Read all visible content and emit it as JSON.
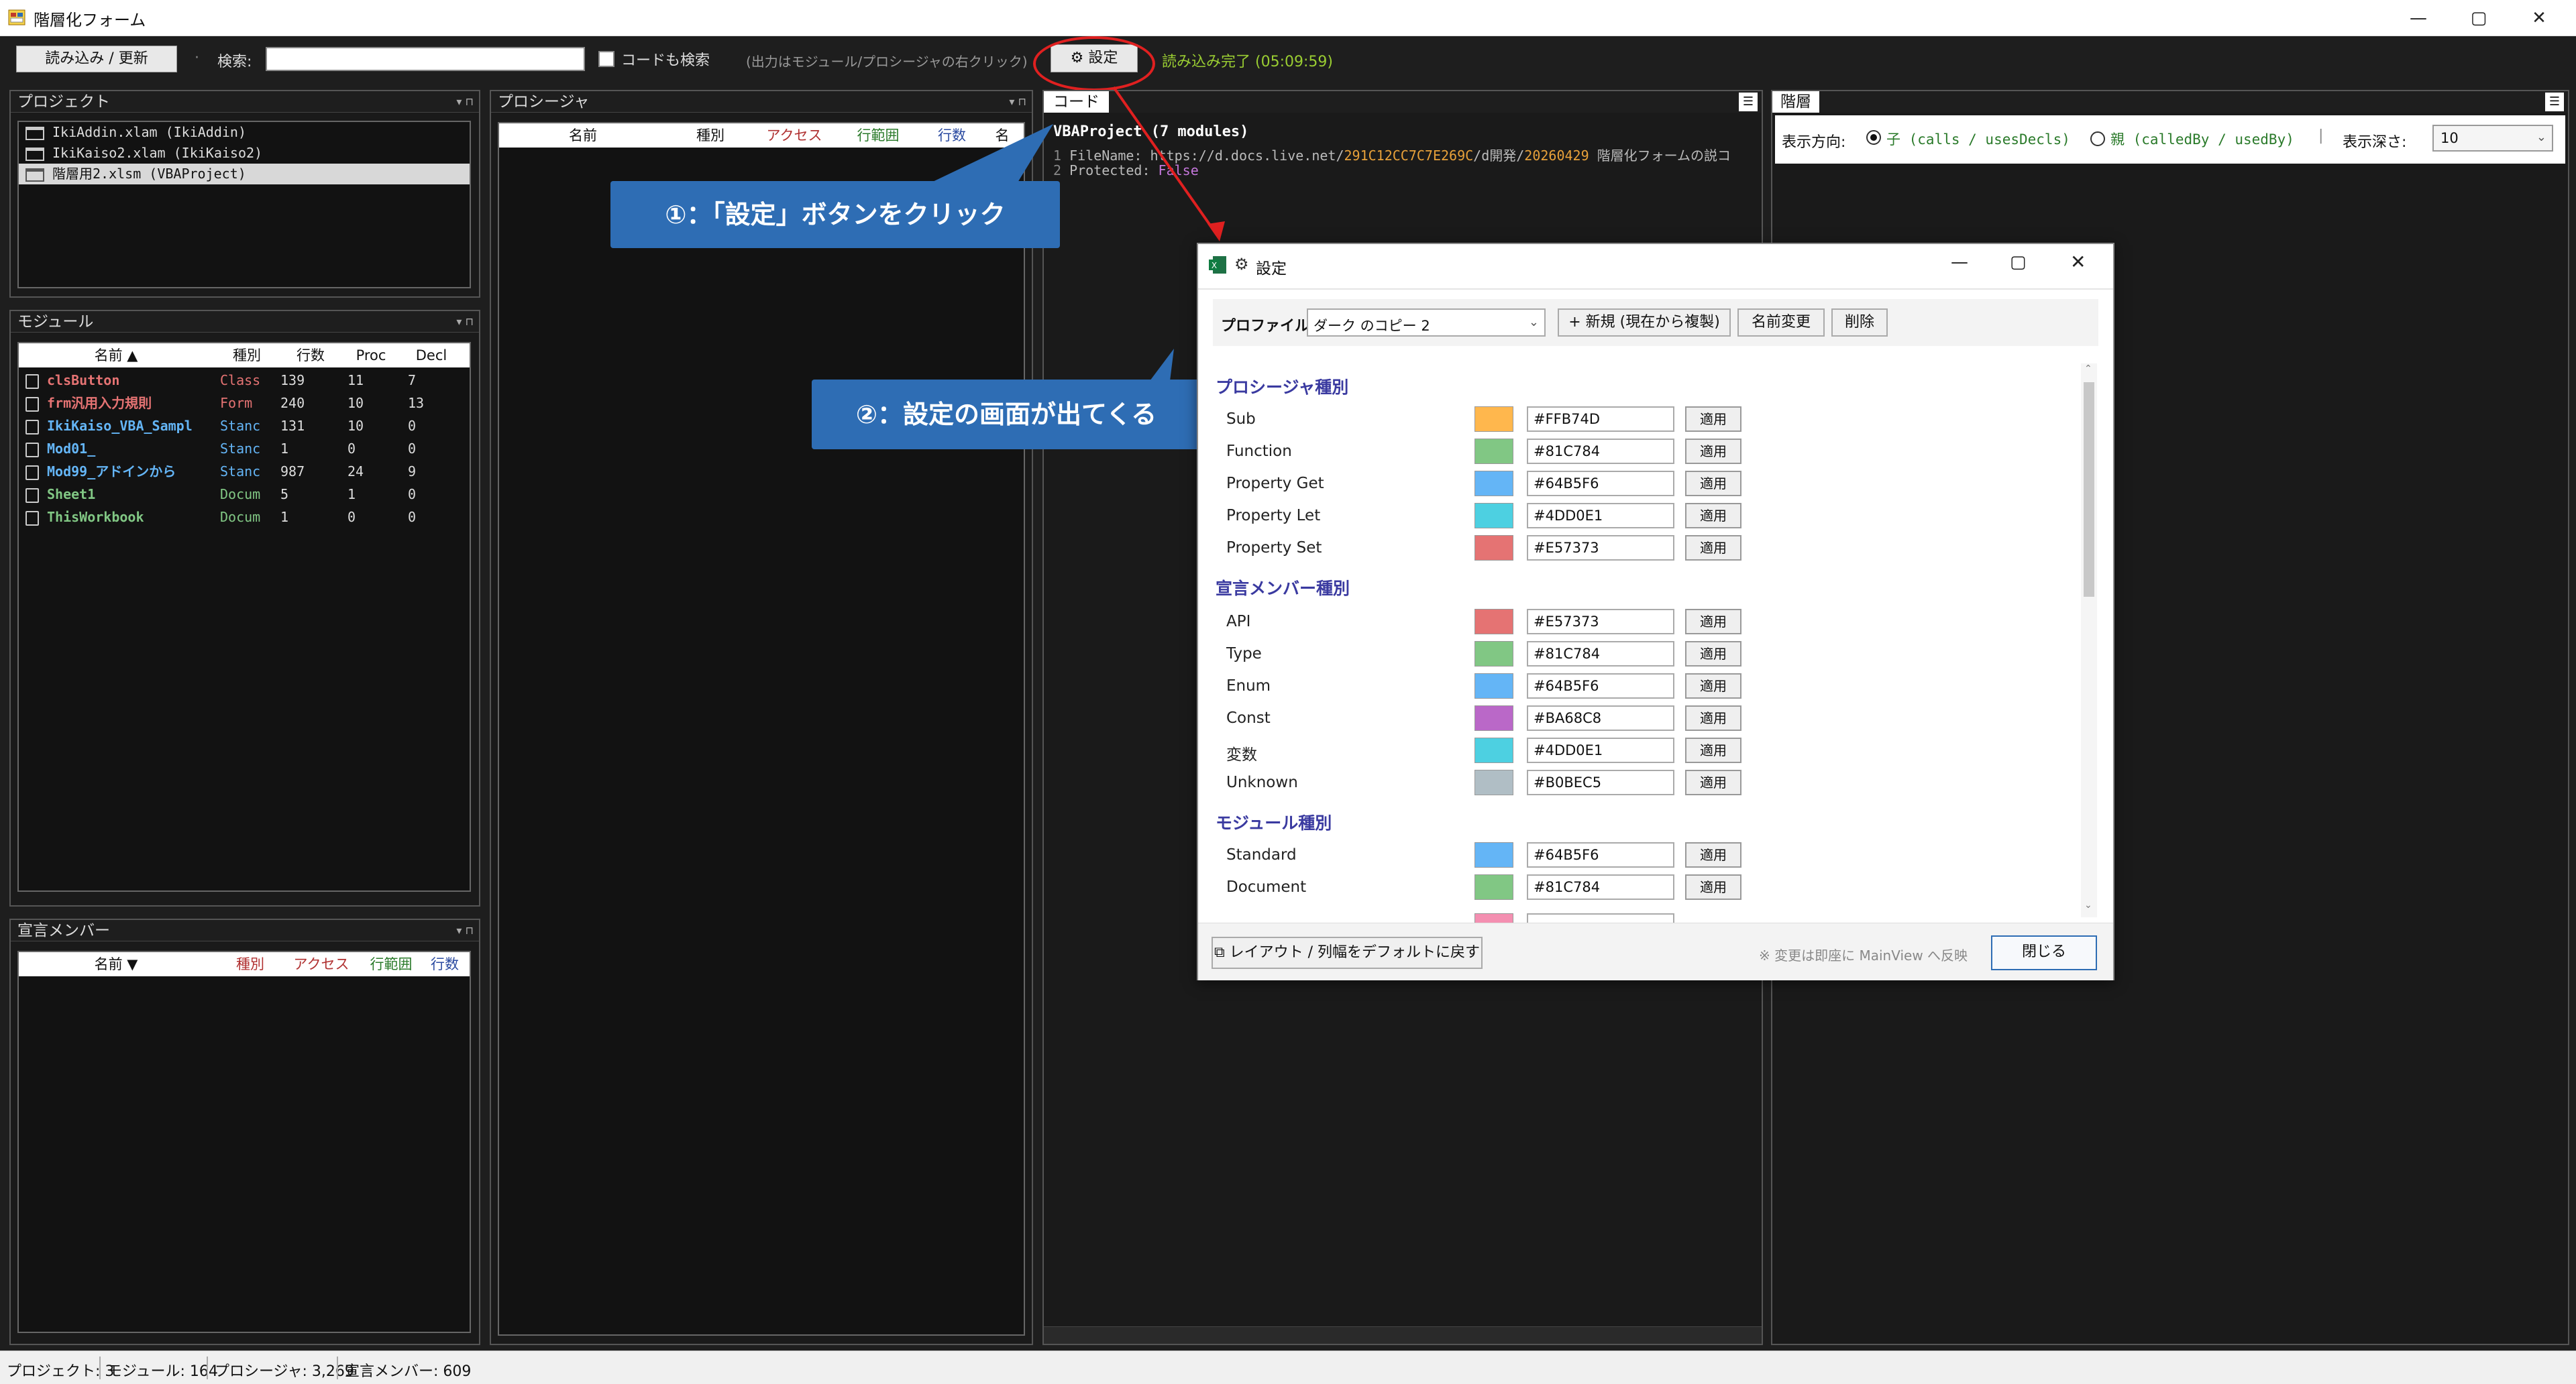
{
  "window": {
    "title": "階層化フォーム",
    "minimize": "—",
    "maximize": "▢",
    "close": "✕"
  },
  "toolbar": {
    "reload_label": "読み込み / 更新",
    "search_label": "検索:",
    "search_value": "",
    "code_search_label": "コードも検索",
    "hint": "(出力はモジュール/プロシージャの右クリック)",
    "settings_label": "設定",
    "status": "読み込み完了 (05:09:59)"
  },
  "project_panel": {
    "title": "プロジェクト",
    "items": [
      "IkiAddin.xlam (IkiAddin)",
      "IkiKaiso2.xlam (IkiKaiso2)",
      "階層用2.xlsm (VBAProject)"
    ]
  },
  "module_panel": {
    "title": "モジュール",
    "columns": [
      "名前 ▲",
      "種別",
      "行数",
      "Proc",
      "Decl"
    ],
    "rows": [
      {
        "name": "clsButton",
        "type": "Class",
        "lines": "139",
        "proc": "11",
        "decl": "7",
        "color": "#E57373"
      },
      {
        "name": "frm汎用入力規則",
        "type": "Form",
        "lines": "240",
        "proc": "10",
        "decl": "13",
        "color": "#E57373"
      },
      {
        "name": "IkiKaiso_VBA_Sampl",
        "type": "Stanc",
        "lines": "131",
        "proc": "10",
        "decl": "0",
        "color": "#64B5F6"
      },
      {
        "name": "Mod01_",
        "type": "Stanc",
        "lines": "1",
        "proc": "0",
        "decl": "0",
        "color": "#64B5F6"
      },
      {
        "name": "Mod99_アドインから",
        "type": "Stanc",
        "lines": "987",
        "proc": "24",
        "decl": "9",
        "color": "#64B5F6"
      },
      {
        "name": "Sheet1",
        "type": "Docum",
        "lines": "5",
        "proc": "1",
        "decl": "0",
        "color": "#81C784"
      },
      {
        "name": "ThisWorkbook",
        "type": "Docum",
        "lines": "1",
        "proc": "0",
        "decl": "0",
        "color": "#81C784"
      }
    ]
  },
  "decl_panel": {
    "title": "宣言メンバー",
    "columns": [
      "名前 ▼",
      "種別",
      "アクセス",
      "行範囲",
      "行数"
    ]
  },
  "proc_panel": {
    "title": "プロシージャ",
    "columns": [
      "名前",
      "種別",
      "アクセス",
      "行範囲",
      "行数",
      "名"
    ]
  },
  "code_panel": {
    "title": "コード",
    "header": "VBAProject (7 modules)",
    "line1_no": "1",
    "line1_key": "FileName: ",
    "line1_url": "https://d.docs.live.net/",
    "line1_hex": "291C12CC7C7E269C",
    "line1_mid": "/d開発/",
    "line1_num": "20260429",
    "line1_tail": " 階層化フォームの説コ",
    "line2_no": "2",
    "line2_key": "Protected: ",
    "line2_val": "False"
  },
  "hierarchy_panel": {
    "title": "階層",
    "direction_label": "表示方向:",
    "child_label": "子 (calls / usesDecls)",
    "parent_label": "親 (calledBy / usedBy)",
    "depth_label": "表示深さ:",
    "depth_value": "10"
  },
  "callouts": {
    "c1": "①：「設定」ボタンをクリック",
    "c2": "②：設定の画面が出てくる"
  },
  "dialog": {
    "title": "設定",
    "profile_label": "プロファイル:",
    "profile_value": "ダーク のコピー 2",
    "new_label": "+ 新規 (現在から複製)",
    "rename_label": "名前変更",
    "delete_label": "削除",
    "apply_label": "適用",
    "sec_proc": "プロシージャ種別",
    "proc": [
      {
        "name": "Sub",
        "hex": "#FFB74D"
      },
      {
        "name": "Function",
        "hex": "#81C784"
      },
      {
        "name": "Property Get",
        "hex": "#64B5F6"
      },
      {
        "name": "Property Let",
        "hex": "#4DD0E1"
      },
      {
        "name": "Property Set",
        "hex": "#E57373"
      }
    ],
    "sec_decl": "宣言メンバー種別",
    "decl": [
      {
        "name": "API",
        "hex": "#E57373"
      },
      {
        "name": "Type",
        "hex": "#81C784"
      },
      {
        "name": "Enum",
        "hex": "#64B5F6"
      },
      {
        "name": "Const",
        "hex": "#BA68C8"
      },
      {
        "name": "変数",
        "hex": "#4DD0E1"
      },
      {
        "name": "Unknown",
        "hex": "#B0BEC5"
      }
    ],
    "sec_mod": "モジュール種別",
    "mod": [
      {
        "name": "Standard",
        "hex": "#64B5F6"
      },
      {
        "name": "Document",
        "hex": "#81C784"
      }
    ],
    "reset_label": "レイアウト / 列幅をデフォルトに戻す",
    "note": "※ 変更は即座に MainView へ反映",
    "close_label": "閉じる"
  },
  "status_bar": {
    "projects": "プロジェクト: 3",
    "modules": "モジュール: 164",
    "procs": "プロシージャ: 3,269",
    "decls": "宣言メンバー: 609"
  }
}
